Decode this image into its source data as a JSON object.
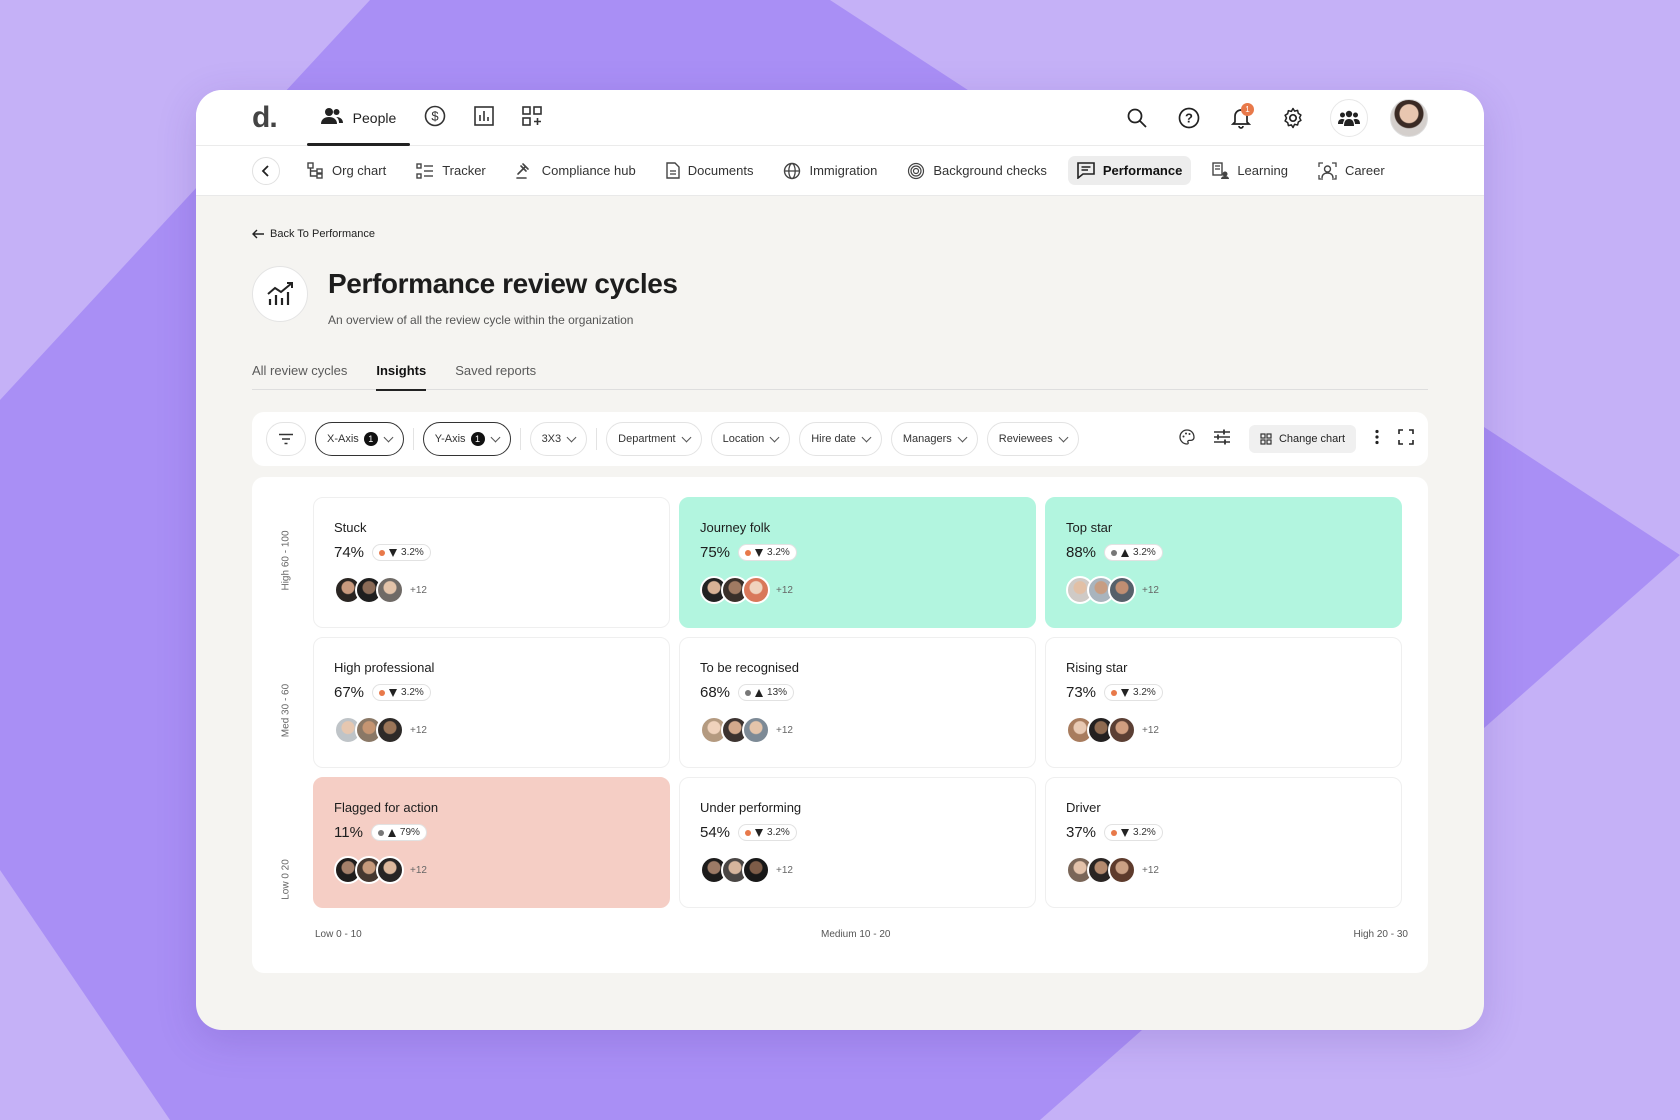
{
  "app": {
    "logo": "d."
  },
  "topnav": {
    "items": [
      {
        "label": "People",
        "icon": "people-icon",
        "active": true
      },
      {
        "label": "",
        "icon": "dollar-icon"
      },
      {
        "label": "",
        "icon": "bar-chart-icon"
      },
      {
        "label": "",
        "icon": "apps-grid-icon"
      }
    ],
    "notifications_count": "1"
  },
  "subnav": {
    "items": [
      {
        "label": "Org chart",
        "icon": "org-chart-icon"
      },
      {
        "label": "Tracker",
        "icon": "tracker-icon"
      },
      {
        "label": "Compliance hub",
        "icon": "gavel-icon"
      },
      {
        "label": "Documents",
        "icon": "document-icon"
      },
      {
        "label": "Immigration",
        "icon": "globe-icon"
      },
      {
        "label": "Background checks",
        "icon": "fingerprint-icon"
      },
      {
        "label": "Performance",
        "icon": "message-icon",
        "active": true
      },
      {
        "label": "Learning",
        "icon": "learning-icon"
      },
      {
        "label": "Career",
        "icon": "career-icon"
      }
    ]
  },
  "page": {
    "back_label": "Back To  Performance",
    "title": "Performance review cycles",
    "subtitle": "An overview of all the review cycle within the organization"
  },
  "tabs": [
    {
      "label": "All  review cycles"
    },
    {
      "label": "Insights",
      "active": true
    },
    {
      "label": "Saved reports"
    }
  ],
  "filters": {
    "x_axis": {
      "label": "X-Axis",
      "count": "1"
    },
    "y_axis": {
      "label": "Y-Axis",
      "count": "1"
    },
    "grid_size": "3X3",
    "dropdowns": [
      "Department",
      "Location",
      "Hire date",
      "Managers",
      "Reviewees"
    ],
    "change_chart": "Change chart"
  },
  "grid": {
    "y_labels": [
      "High 60 - 100",
      "Med 30 - 60",
      "Low 0 20"
    ],
    "x_labels": [
      "Low 0 - 10",
      "Medium 10 - 20",
      "High 20 - 30"
    ],
    "cells": [
      {
        "name": "Stuck",
        "pct": "74%",
        "change": "3.2%",
        "trend": "down",
        "dot": "#e8794a",
        "more": "+12",
        "bg": "white"
      },
      {
        "name": "Journey folk",
        "pct": "75%",
        "change": "3.2%",
        "trend": "down",
        "dot": "#e8794a",
        "more": "+12",
        "bg": "green"
      },
      {
        "name": "Top star",
        "pct": "88%",
        "change": "3.2%",
        "trend": "up",
        "dot": "#777777",
        "more": "+12",
        "bg": "green"
      },
      {
        "name": "High professional",
        "pct": "67%",
        "change": "3.2%",
        "trend": "down",
        "dot": "#e8794a",
        "more": "+12",
        "bg": "white"
      },
      {
        "name": "To be recognised",
        "pct": "68%",
        "change": "13%",
        "trend": "up",
        "dot": "#777777",
        "more": "+12",
        "bg": "white"
      },
      {
        "name": "Rising star",
        "pct": "73%",
        "change": "3.2%",
        "trend": "down",
        "dot": "#e8794a",
        "more": "+12",
        "bg": "white"
      },
      {
        "name": "Flagged for action",
        "pct": "11%",
        "change": "79%",
        "trend": "up",
        "dot": "#777777",
        "more": "+12",
        "bg": "red"
      },
      {
        "name": "Under performing",
        "pct": "54%",
        "change": "3.2%",
        "trend": "down",
        "dot": "#e8794a",
        "more": "+12",
        "bg": "white"
      },
      {
        "name": "Driver",
        "pct": "37%",
        "change": "3.2%",
        "trend": "down",
        "dot": "#e8794a",
        "more": "+12",
        "bg": "white"
      }
    ]
  },
  "colors": {
    "accent_green": "#b2f5df",
    "accent_red": "#f5cec5",
    "badge_orange": "#e8794a",
    "background_purple": "#c5b1f7"
  }
}
